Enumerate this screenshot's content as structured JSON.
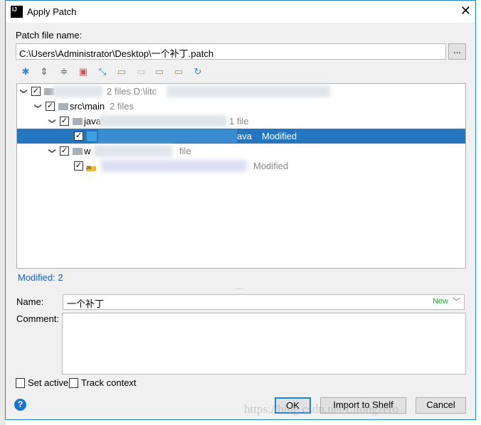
{
  "window": {
    "title": "Apply Patch",
    "close": "✕"
  },
  "patch_file": {
    "label": "Patch file name:",
    "value": "C:\\Users\\Administrator\\Desktop\\一个补丁.patch",
    "browse": "..."
  },
  "toolbar": [
    "settings-icon",
    "expand-all-icon",
    "collapse-all-icon",
    "show-diff-icon",
    "map-directory-icon",
    "include-icon",
    "exclude-icon",
    "restore-icon",
    "remove-icon",
    "refresh-icon"
  ],
  "tree": {
    "rows": [
      {
        "name": "",
        "info": "2 files  D:\\litc"
      },
      {
        "name": "src\\main",
        "info": "2 files"
      },
      {
        "name": "java",
        "info": "1 file"
      },
      {
        "name": "ava",
        "info": "Modified"
      },
      {
        "name": "w",
        "info": "file"
      },
      {
        "name": "",
        "info": "Modified"
      }
    ]
  },
  "status": "Modified: 2",
  "name_field": {
    "label": "Name:",
    "value": "一个补丁",
    "badge": "New"
  },
  "comment": {
    "label": "Comment:",
    "value": ""
  },
  "options": {
    "set_active": "Set active",
    "track_context": "Track context"
  },
  "buttons": {
    "ok": "OK",
    "import": "Import to Shelf",
    "cancel": "Cancel"
  },
  "watermark": "https://blog.csdn.net/Litongzero",
  "colors": {
    "accent": "#1883d7",
    "selection": "#2675bf",
    "status": "#1a5fb4",
    "new_badge": "#22a52f"
  }
}
